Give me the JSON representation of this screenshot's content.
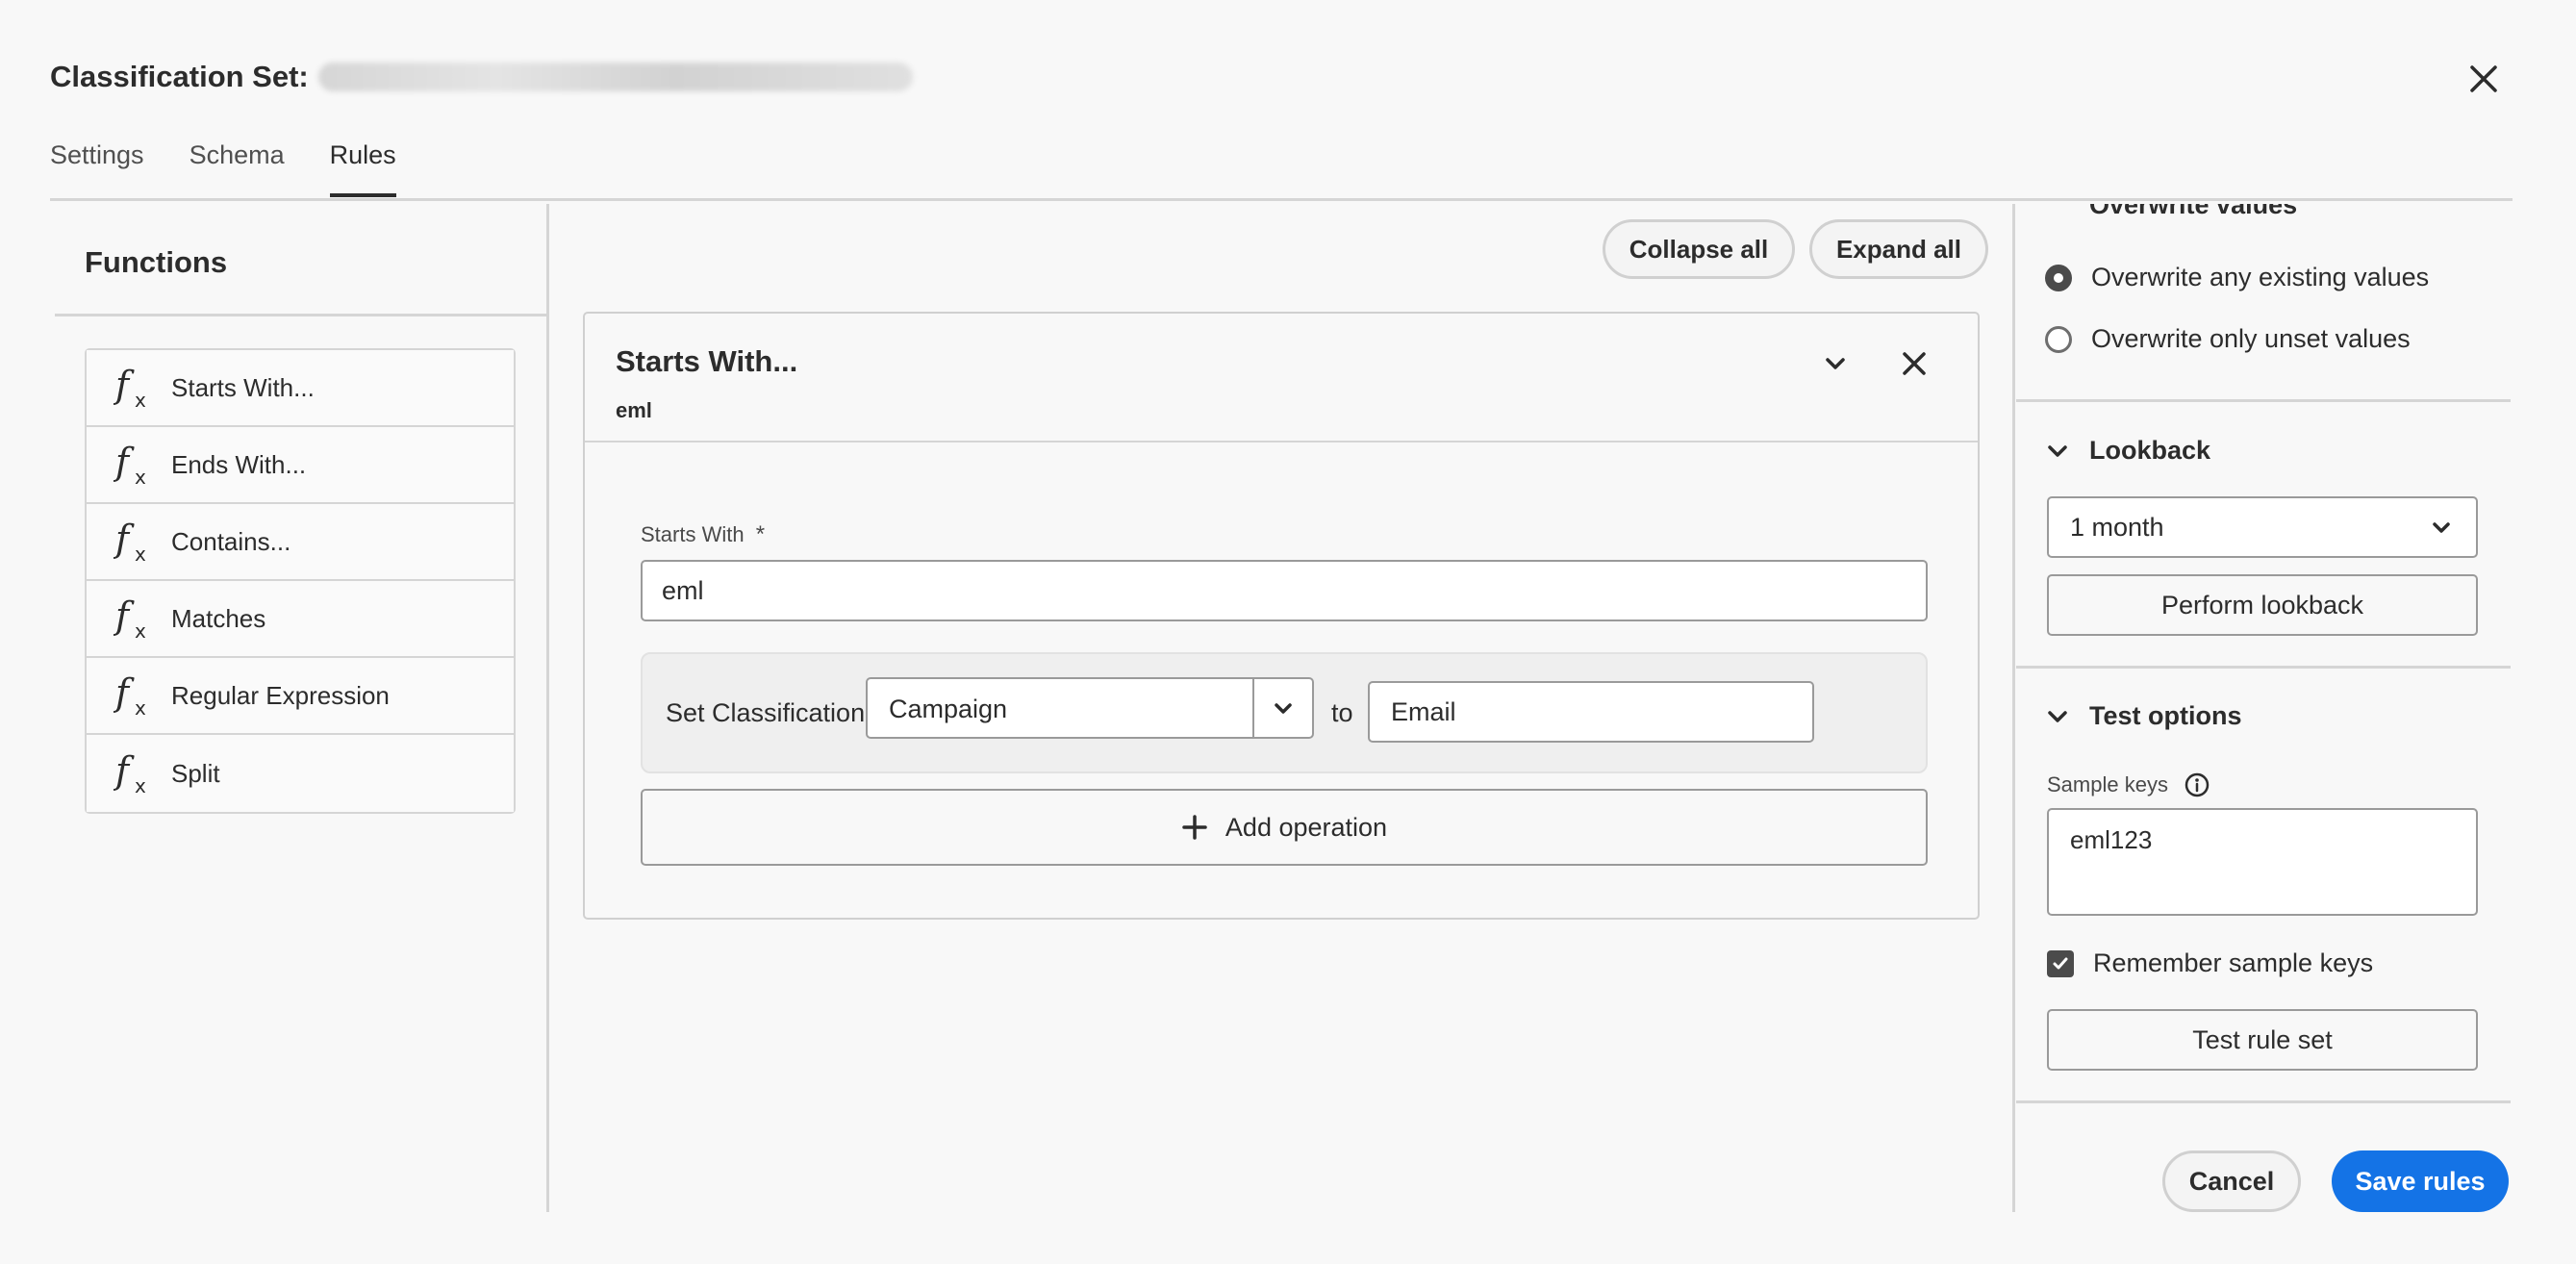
{
  "header": {
    "title": "Classification Set:",
    "close_icon": "close-icon"
  },
  "tabs": [
    {
      "label": "Settings",
      "active": false
    },
    {
      "label": "Schema",
      "active": false
    },
    {
      "label": "Rules",
      "active": true
    }
  ],
  "functions": {
    "title": "Functions",
    "items": [
      {
        "label": "Starts With...",
        "icon": "function-icon"
      },
      {
        "label": "Ends With...",
        "icon": "function-icon"
      },
      {
        "label": "Contains...",
        "icon": "function-icon"
      },
      {
        "label": "Matches",
        "icon": "function-icon"
      },
      {
        "label": "Regular Expression",
        "icon": "function-icon"
      },
      {
        "label": "Split",
        "icon": "function-icon"
      }
    ]
  },
  "toolbar": {
    "collapse_label": "Collapse all",
    "expand_label": "Expand all"
  },
  "rule": {
    "title": "Starts With...",
    "subtitle": "eml",
    "field_label": "Starts With",
    "required_marker": "*",
    "field_value": "eml",
    "operation": {
      "label": "Set Classification",
      "classification": "Campaign",
      "to_label": "to",
      "value": "Email"
    },
    "add_operation_label": "Add operation"
  },
  "right_panel": {
    "overwrite": {
      "heading": "Overwrite values",
      "options": [
        {
          "label": "Overwrite any existing values",
          "checked": true
        },
        {
          "label": "Overwrite only unset values",
          "checked": false
        }
      ]
    },
    "lookback": {
      "heading": "Lookback",
      "selected": "1 month",
      "button_label": "Perform lookback"
    },
    "test_options": {
      "heading": "Test options",
      "sample_keys_label": "Sample keys",
      "sample_keys_value": "eml123",
      "remember_label": "Remember sample keys",
      "remember_checked": true,
      "test_button_label": "Test rule set"
    }
  },
  "footer": {
    "cancel_label": "Cancel",
    "save_label": "Save rules"
  },
  "colors": {
    "accent": "#1473e6",
    "background": "#f8f8f8",
    "border": "#d5d5d5"
  }
}
